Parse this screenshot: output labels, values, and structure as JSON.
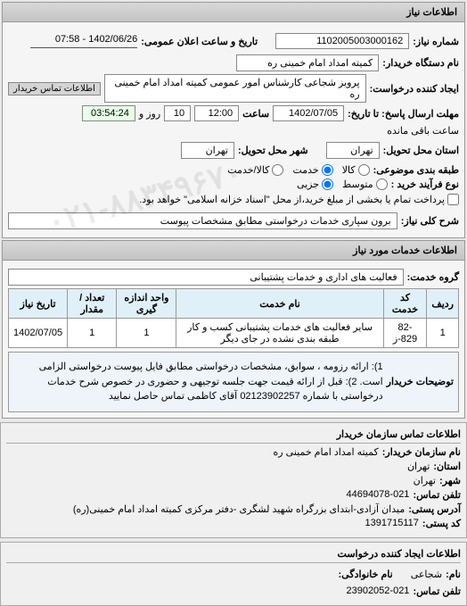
{
  "watermark": "۰۲۱-۸۸۳۴۹۶۷۰",
  "panel1_title": "اطلاعات نیاز",
  "req_number_label": "شماره نیاز:",
  "req_number": "1102005003000162",
  "announce_label": "تاریخ و ساعت اعلان عمومی:",
  "announce_val": "1402/06/26 - 07:58",
  "buyer_label": "نام دستگاه خریدار:",
  "buyer_val": "کمیته امداد امام خمینی ره",
  "creator_label": "ایجاد کننده درخواست:",
  "creator_val": "پرویز شجاعی کارشناس امور عمومی کمیته امداد امام خمینی ره",
  "contact_link": "اطلاعات تماس خریدار",
  "deadline_label": "مهلت ارسال پاسخ: تا تاریخ:",
  "deadline_date": "1402/07/05",
  "time_label": "ساعت",
  "deadline_time": "12:00",
  "days_remain": "10",
  "days_label": "روز و",
  "time_remain": "03:54:24",
  "time_remain_label": "ساعت باقی مانده",
  "province_label": "استان محل تحویل:",
  "province_val": "تهران",
  "city_label": "شهر محل تحویل:",
  "city_val": "تهران",
  "budget_label": "طبقه بندی موضوعی:",
  "budget_options": [
    "کالا",
    "خدمت",
    "کالا/خدمت"
  ],
  "size_label": "نوع فرآیند خرید :",
  "size_options": [
    "متوسط",
    "جزیی"
  ],
  "payment_note": "پرداخت تمام یا بخشی از مبلغ خرید،از محل \"اسناد خزانه اسلامی\" خواهد بود.",
  "summary_label": "شرح کلی نیاز:",
  "summary_val": "برون سپاری خدمات درخواستی مطابق مشخصات پیوست",
  "panel2_title": "اطلاعات خدمات مورد نیاز",
  "group_label": "گروه خدمت:",
  "group_val": "فعالیت های اداری و خدمات پشتیبانی",
  "table": {
    "headers": [
      "ردیف",
      "کد خدمت",
      "نام خدمت",
      "واحد اندازه گیری",
      "تعداد / مقدار",
      "تاریخ نیاز"
    ],
    "rows": [
      [
        "1",
        "82-829-ز",
        "سایر فعالیت های خدمات پشتیبانی کسب و کار طبقه بندی نشده در جای دیگر",
        "1",
        "1",
        "1402/07/05"
      ]
    ]
  },
  "desc_label": "توضیحات خریدار",
  "desc_text": "1): ارائه رزومه ، سوابق، مشخصات درخواستی مطابق فایل پیوست درخواستی الزامی است. 2): قبل از ارائه قیمت جهت جلسه توجیهی و حضوری در خصوص شرح خدمات درخواستی با شماره 02123902257 آقای کاظمی تماس حاصل نمایید",
  "contact_buyer": {
    "header": "اطلاعات تماس سازمان خریدار",
    "org_label": "نام سازمان خریدار:",
    "org_val": "کمیته امداد امام خمینی ره",
    "prov_label": "استان:",
    "prov_val": "تهران",
    "city_label": "شهر:",
    "city_val": "تهران",
    "phone_label": "تلفن تماس:",
    "phone_val": "44694078-021",
    "address_label": "آدرس پستی:",
    "address_val": "میدان آزادی-ابتدای بزرگراه شهید لشگری -دفتر مرکزی کمیته امداد امام خمینی(ره)",
    "postal_label": "کد پستی:",
    "postal_val": "1391715117"
  },
  "contact_creator": {
    "header": "اطلاعات ایجاد کننده درخواست",
    "name_label": "نام:",
    "name_val": "شجاعی",
    "family_label": "نام خانوادگی:",
    "family_val": "",
    "phone_label": "تلفن تماس:",
    "phone_val": "23902052-021"
  }
}
